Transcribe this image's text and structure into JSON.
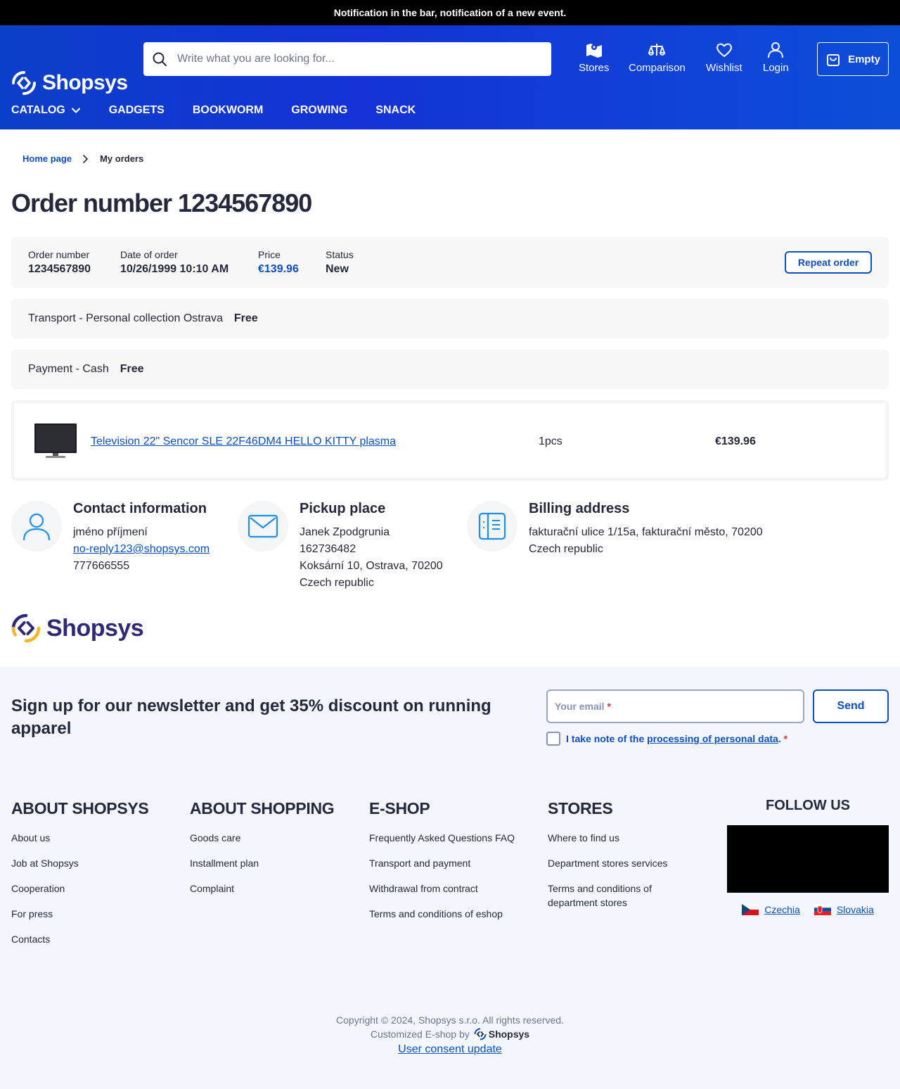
{
  "notification": "Notification in the bar, notification of a new event.",
  "header": {
    "logo_text": "Shopsys",
    "search_placeholder": "Write what you are looking for...",
    "nav": {
      "stores": "Stores",
      "comparison": "Comparison",
      "wishlist": "Wishlist",
      "login": "Login"
    },
    "cart_label": "Empty"
  },
  "menu": [
    "CATALOG",
    "GADGETS",
    "BOOKWORM",
    "GROWING",
    "SNACK"
  ],
  "breadcrumb": {
    "home": "Home page",
    "current": "My orders"
  },
  "title": "Order number 1234567890",
  "summary": {
    "order_number_label": "Order number",
    "order_number": "1234567890",
    "date_label": "Date of order",
    "date": "10/26/1999 10:10 AM",
    "price_label": "Price",
    "price": "€139.96",
    "status_label": "Status",
    "status": "New",
    "repeat_button": "Repeat order"
  },
  "transport": {
    "label": "Transport - Personal collection Ostrava",
    "price": "Free"
  },
  "payment": {
    "label": "Payment - Cash",
    "price": "Free"
  },
  "product": {
    "name": "Television 22\" Sencor SLE 22F46DM4 HELLO KITTY plasma",
    "quantity": "1pcs",
    "price": "€139.96"
  },
  "contact": {
    "title": "Contact information",
    "name": "jméno příjmení",
    "email": "no-reply123@shopsys.com",
    "phone": "777666555"
  },
  "pickup": {
    "title": "Pickup place",
    "name": "Janek Zpodgrunia",
    "id": "162736482",
    "address": "Koksární 10, Ostrava, 70200",
    "country": "Czech republic"
  },
  "billing": {
    "title": "Billing address",
    "address": "fakturační ulice 1/15a, fakturační město, 70200",
    "country": "Czech republic"
  },
  "footer_logo": "Shopsys",
  "newsletter": {
    "title": "Sign up for our newsletter and get 35% discount on running apparel",
    "email_placeholder": "Your email",
    "required_mark": "*",
    "send": "Send",
    "consent_prefix": "I take note of the ",
    "consent_link": "processing of personal data",
    "consent_suffix": "."
  },
  "footer_columns": [
    {
      "title": "ABOUT SHOPSYS",
      "links": [
        "About us",
        "Job at Shopsys",
        "Cooperation",
        "For press",
        "Contacts"
      ]
    },
    {
      "title": "ABOUT SHOPPING",
      "links": [
        "Goods care",
        "Installment plan",
        "Complaint"
      ]
    },
    {
      "title": "E-SHOP",
      "links": [
        "Frequently Asked Questions FAQ",
        "Transport and payment",
        "Withdrawal from contract",
        "Terms and conditions of eshop"
      ]
    },
    {
      "title": "STORES",
      "links": [
        "Where to find us",
        "Department stores services",
        "Terms and conditions of department stores"
      ]
    }
  ],
  "follow": {
    "title": "FOLLOW US",
    "langs": [
      "Czechia",
      "Slovakia"
    ]
  },
  "copyright": {
    "text": "Copyright © 2024, Shopsys s.r.o. All rights reserved.",
    "customized": "Customized E-shop by",
    "brand": "Shopsys",
    "consent_update": "User consent update"
  },
  "colors": {
    "primary": "#0c4fbf",
    "header_blue": "#1432d6",
    "text": "#25283d",
    "footer_bg": "#f3f7fd"
  }
}
